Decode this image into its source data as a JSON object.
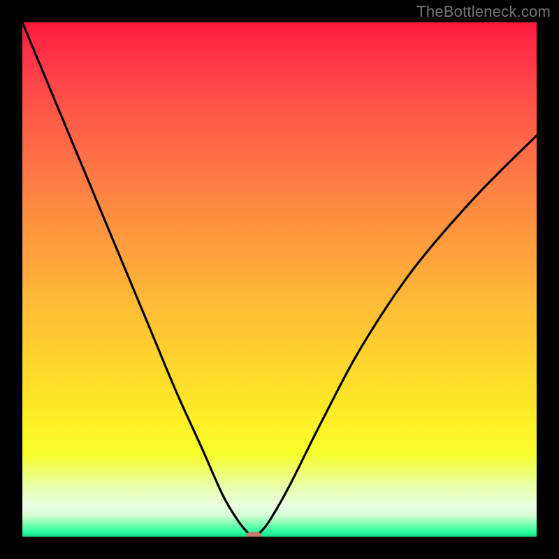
{
  "watermark": "TheBottleneck.com",
  "colors": {
    "frame": "#000000",
    "curve": "#000000",
    "marker": "#c97b6e"
  },
  "chart_data": {
    "type": "line",
    "title": "",
    "xlabel": "",
    "ylabel": "",
    "xlim": [
      0,
      100
    ],
    "ylim": [
      0,
      100
    ],
    "series": [
      {
        "name": "bottleneck-curve",
        "x": [
          0,
          5,
          10,
          15,
          20,
          25,
          30,
          35,
          39,
          42,
          44,
          45,
          46,
          48,
          52,
          58,
          66,
          76,
          88,
          100
        ],
        "y": [
          100,
          88,
          76,
          64,
          52,
          40,
          28,
          17,
          8,
          3,
          0.6,
          0,
          0.6,
          3,
          10,
          22,
          37,
          52,
          66,
          78
        ]
      }
    ],
    "marker": {
      "x": 45,
      "y": 0
    },
    "background_gradient": {
      "top": "#ff1a3e",
      "mid": "#ffd52e",
      "bottom": "#17dd88"
    }
  }
}
